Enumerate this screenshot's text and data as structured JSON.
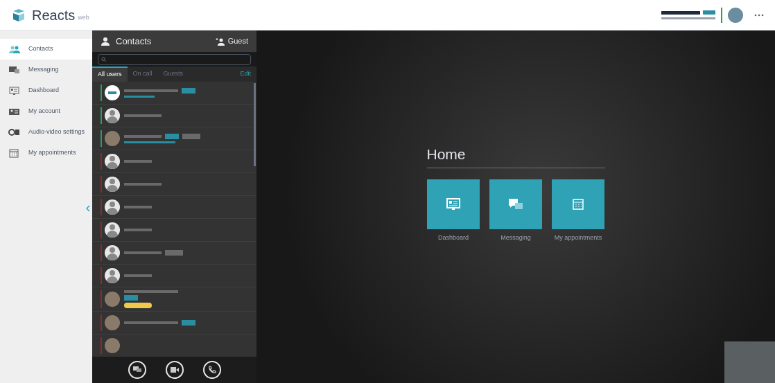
{
  "header": {
    "logo": "Reacts",
    "logo_suffix": "web",
    "user_status": {
      "color": "#2f9e5a"
    }
  },
  "sidebar": {
    "items": [
      {
        "label": "Contacts",
        "selected": true
      },
      {
        "label": "Messaging",
        "selected": false
      },
      {
        "label": "Dashboard",
        "selected": false
      },
      {
        "label": "My account",
        "selected": false
      },
      {
        "label": "Audio-video settings",
        "selected": false
      },
      {
        "label": "My appointments",
        "selected": false
      }
    ]
  },
  "contacts_panel": {
    "title": "Contacts",
    "guest_button": "Guest",
    "tabs": [
      {
        "label": "All users",
        "selected": true
      },
      {
        "label": "On call",
        "selected": false
      },
      {
        "label": "Guests",
        "selected": false
      }
    ],
    "edit_link": "Edit",
    "contacts": [
      {
        "color": "#2f9e5a",
        "kind": "logo"
      },
      {
        "color": "#2f9e5a",
        "kind": "default"
      },
      {
        "color": "#2f9e5a",
        "kind": "photo"
      },
      {
        "color": "#8b2c2c",
        "kind": "default"
      },
      {
        "color": "#8b2c2c",
        "kind": "default"
      },
      {
        "color": "#8b2c2c",
        "kind": "default"
      },
      {
        "color": "#8b2c2c",
        "kind": "default"
      },
      {
        "color": "#8b2c2c",
        "kind": "default"
      },
      {
        "color": "#8b2c2c",
        "kind": "default"
      },
      {
        "color": "#8b2c2c",
        "kind": "photo"
      },
      {
        "color": "#8b2c2c",
        "kind": "photo"
      },
      {
        "color": "#8b2c2c",
        "kind": "photo"
      }
    ]
  },
  "home": {
    "title": "Home",
    "tiles": [
      {
        "label": "Dashboard"
      },
      {
        "label": "Messaging"
      },
      {
        "label": "My appointments"
      }
    ]
  }
}
